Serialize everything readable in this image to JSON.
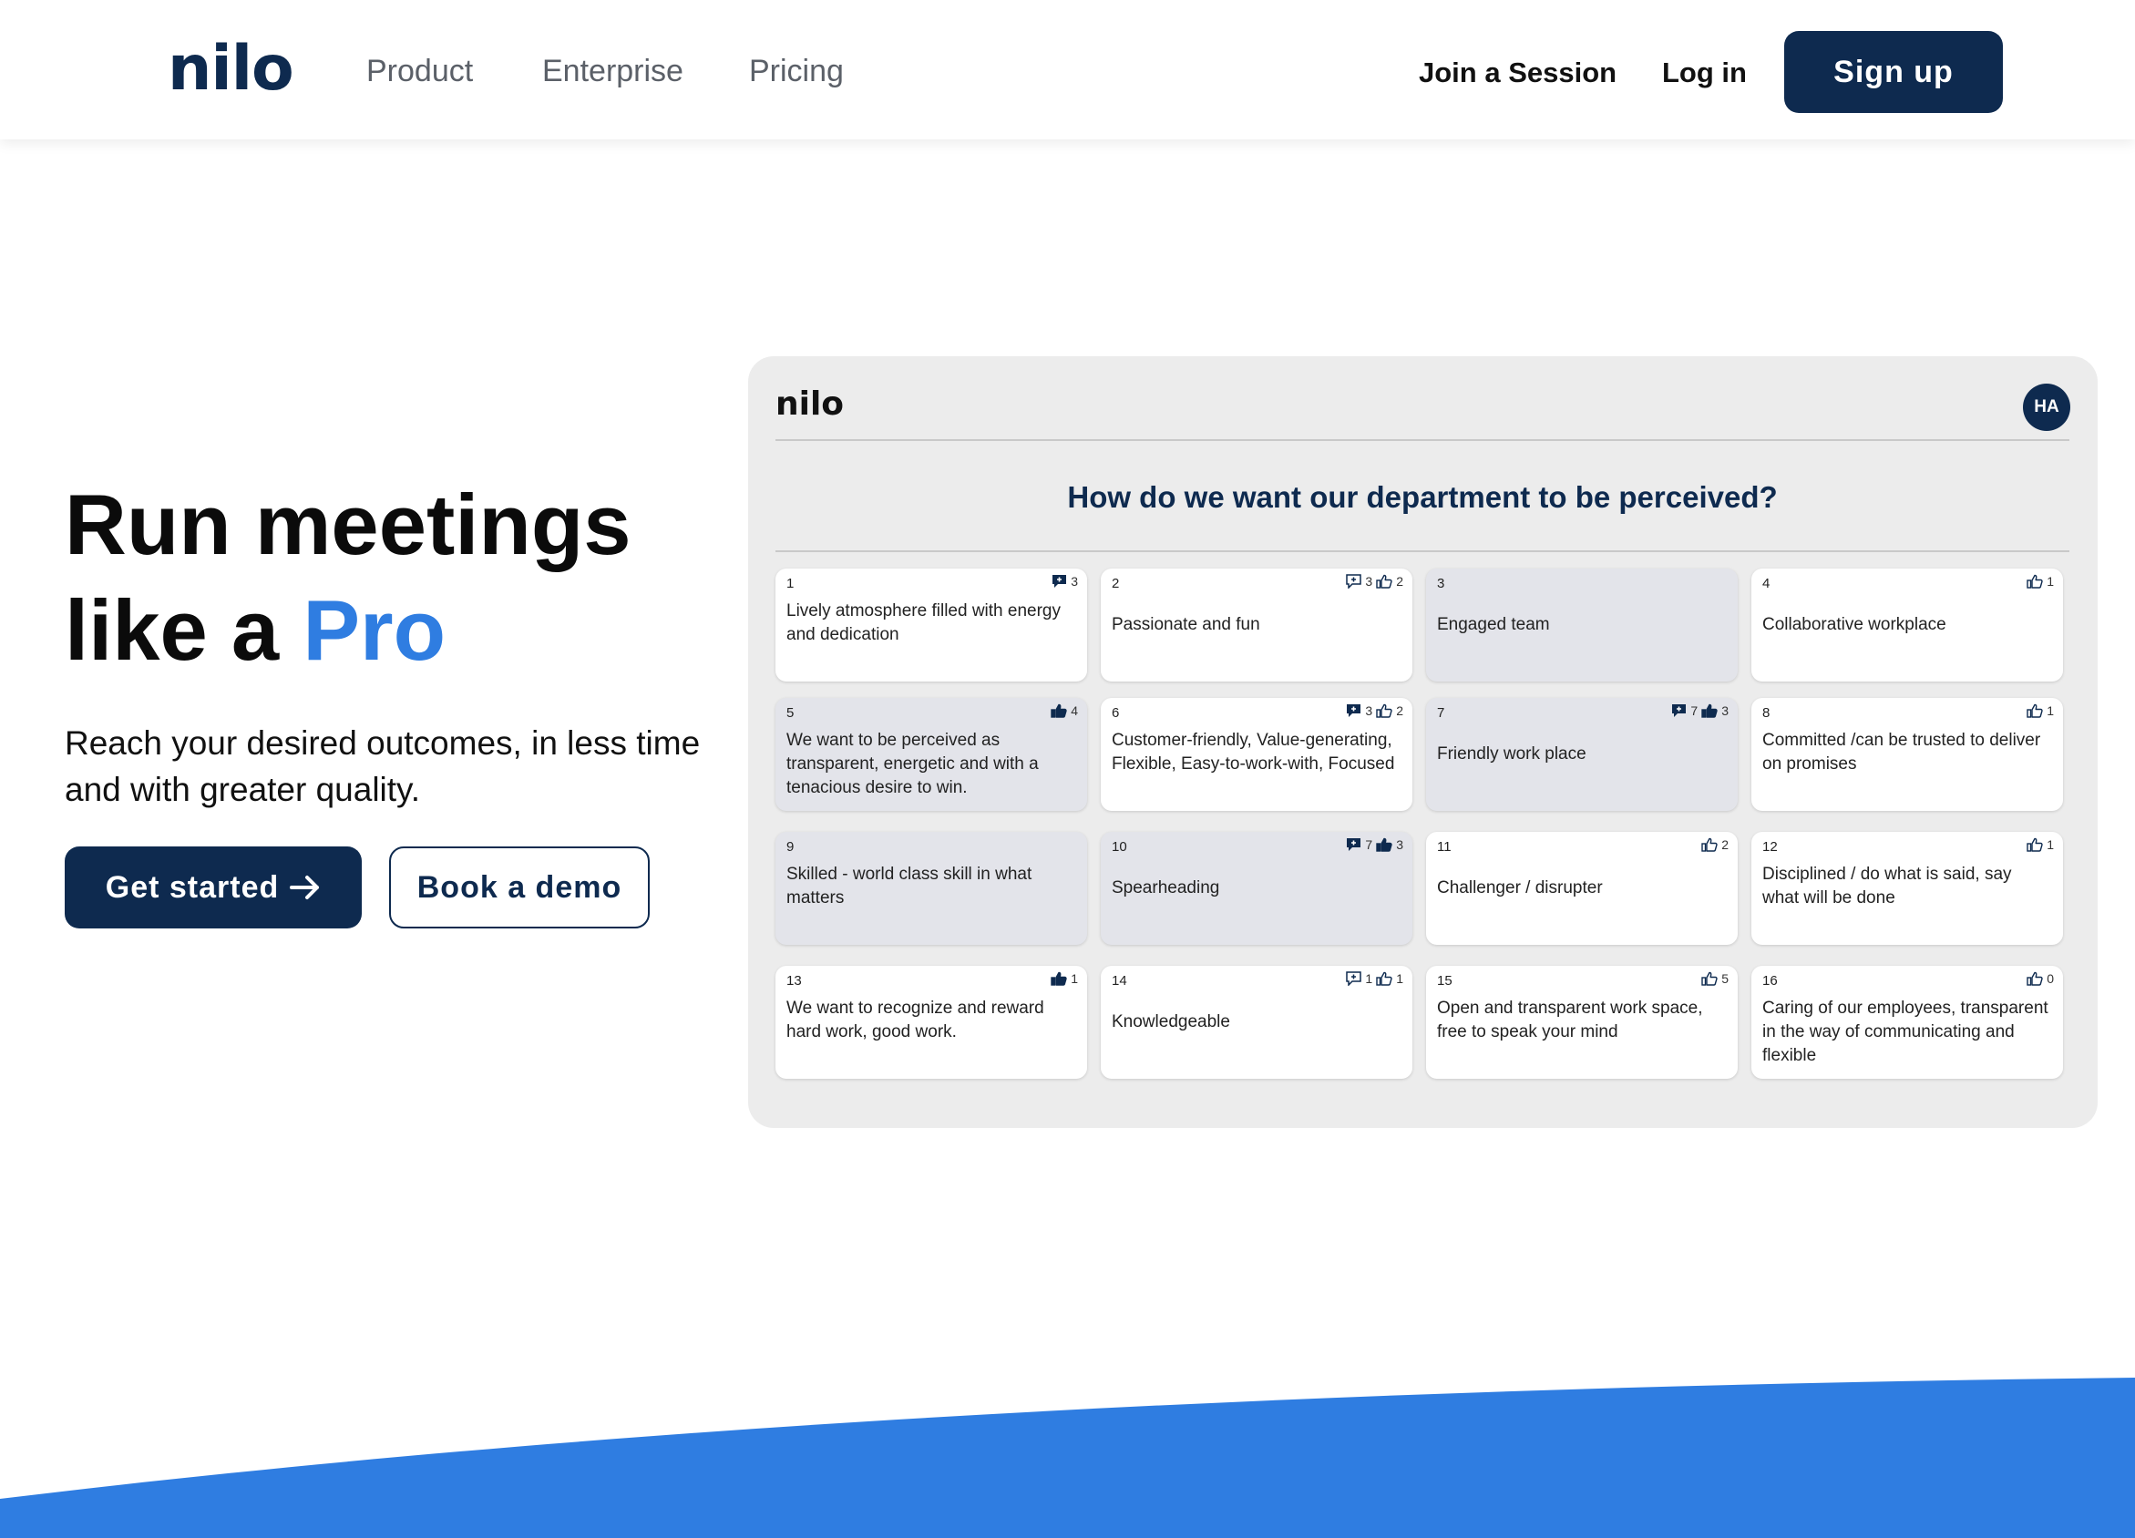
{
  "header": {
    "logo": "nilo",
    "nav": [
      "Product",
      "Enterprise",
      "Pricing"
    ],
    "join_session": "Join a Session",
    "login": "Log in",
    "signup": "Sign up"
  },
  "hero": {
    "title_line1": "Run meetings",
    "title_line2_prefix": "like a ",
    "title_line2_accent": "Pro",
    "subtitle": "Reach your desired outcomes, in less time and with greater quality.",
    "get_started": "Get started",
    "book_demo": "Book a demo"
  },
  "colors": {
    "navy": "#0e2a4f",
    "accent_blue": "#2f7de1",
    "preview_bg": "#ececec",
    "card_shaded": "#e3e4ea"
  },
  "preview": {
    "logo": "nilo",
    "avatar": "HA",
    "question": "How do we want our department to be perceived?",
    "cards": [
      {
        "num": "1",
        "text": "Lively atmosphere filled with energy and dedication",
        "shaded": false,
        "comment_filled": true,
        "comments": "3",
        "likes": null,
        "like_filled": false
      },
      {
        "num": "2",
        "text": "Passionate and fun",
        "shaded": false,
        "comment_filled": false,
        "comments": "3",
        "likes": "2",
        "like_filled": false
      },
      {
        "num": "3",
        "text": "Engaged team",
        "shaded": true,
        "comment_filled": false,
        "comments": null,
        "likes": null,
        "like_filled": false
      },
      {
        "num": "4",
        "text": "Collaborative workplace",
        "shaded": false,
        "comment_filled": false,
        "comments": null,
        "likes": "1",
        "like_filled": false
      },
      {
        "num": "5",
        "text": "We want to be perceived as transparent, energetic and with a tenacious desire to win.",
        "shaded": true,
        "comment_filled": false,
        "comments": null,
        "likes": "4",
        "like_filled": true
      },
      {
        "num": "6",
        "text": "Customer-friendly, Value-generating, Flexible, Easy-to-work-with, Focused",
        "shaded": false,
        "comment_filled": true,
        "comments": "3",
        "likes": "2",
        "like_filled": false
      },
      {
        "num": "7",
        "text": "Friendly work place",
        "shaded": true,
        "comment_filled": true,
        "comments": "7",
        "likes": "3",
        "like_filled": true
      },
      {
        "num": "8",
        "text": "Committed /can be trusted to deliver on promises",
        "shaded": false,
        "comment_filled": false,
        "comments": null,
        "likes": "1",
        "like_filled": false
      },
      {
        "num": "9",
        "text": "Skilled - world class skill in what matters",
        "shaded": true,
        "comment_filled": false,
        "comments": null,
        "likes": null,
        "like_filled": false
      },
      {
        "num": "10",
        "text": "Spearheading",
        "shaded": true,
        "comment_filled": true,
        "comments": "7",
        "likes": "3",
        "like_filled": true
      },
      {
        "num": "11",
        "text": "Challenger / disrupter",
        "shaded": false,
        "comment_filled": false,
        "comments": null,
        "likes": "2",
        "like_filled": false
      },
      {
        "num": "12",
        "text": "Disciplined / do what is said, say what will be done",
        "shaded": false,
        "comment_filled": false,
        "comments": null,
        "likes": "1",
        "like_filled": false
      },
      {
        "num": "13",
        "text": "We want to recognize and reward hard work, good work.",
        "shaded": false,
        "comment_filled": false,
        "comments": null,
        "likes": "1",
        "like_filled": true
      },
      {
        "num": "14",
        "text": "Knowledgeable",
        "shaded": false,
        "comment_filled": false,
        "comments": "1",
        "likes": "1",
        "like_filled": false
      },
      {
        "num": "15",
        "text": "Open and transparent work space, free to speak your mind",
        "shaded": false,
        "comment_filled": false,
        "comments": null,
        "likes": "5",
        "like_filled": false
      },
      {
        "num": "16",
        "text": "Caring of our employees, transparent in the way of communicating and flexible",
        "shaded": false,
        "comment_filled": false,
        "comments": null,
        "likes": "0",
        "like_filled": false
      }
    ]
  }
}
